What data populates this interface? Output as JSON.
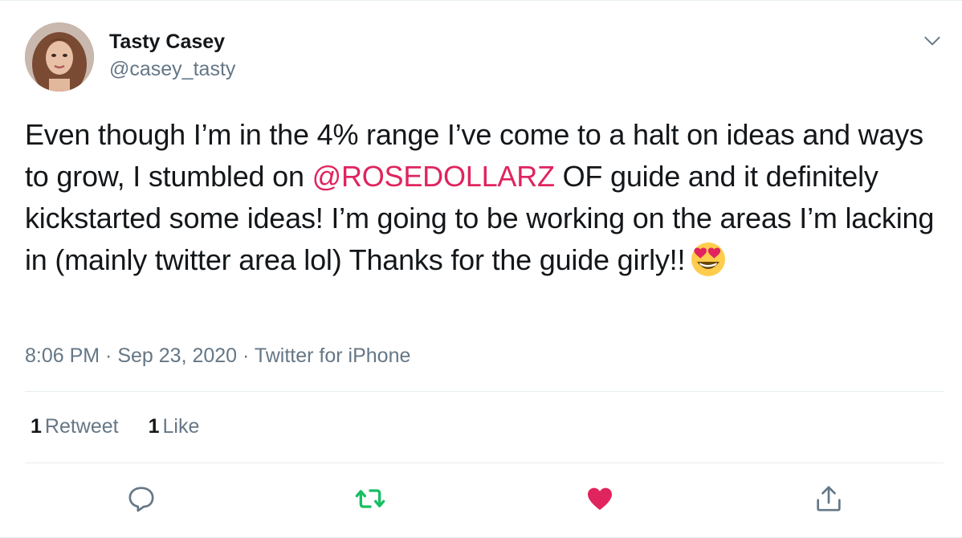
{
  "user": {
    "display_name": "Tasty Casey",
    "handle": "@casey_tasty"
  },
  "tweet": {
    "text_before": "Even though I’m in the 4% range I’ve come to a halt on ideas and ways to grow, I stumbled on ",
    "mention": "@ROSEDOLLARZ",
    "text_after": " OF guide and it definitely kickstarted some ideas! I’m going to be working on the areas I’m lacking in (mainly twitter area lol) Thanks for the guide girly!!",
    "emoji": "heart-eyes-emoji"
  },
  "meta": {
    "time": "8:06 PM",
    "separator": " · ",
    "date": "Sep 23, 2020",
    "source": "Twitter for iPhone"
  },
  "stats": {
    "retweets_count": "1",
    "retweets_label": "Retweet",
    "likes_count": "1",
    "likes_label": "Like"
  },
  "actions": {
    "reply_icon": "reply-icon",
    "retweet_icon": "retweet-icon",
    "like_icon": "heart-icon",
    "share_icon": "share-icon"
  },
  "colors": {
    "mention": "#e0245e",
    "secondary_text": "#657786",
    "retweet_active": "#17bf63",
    "like_active": "#e0245e",
    "divider": "#e6ecf0"
  }
}
